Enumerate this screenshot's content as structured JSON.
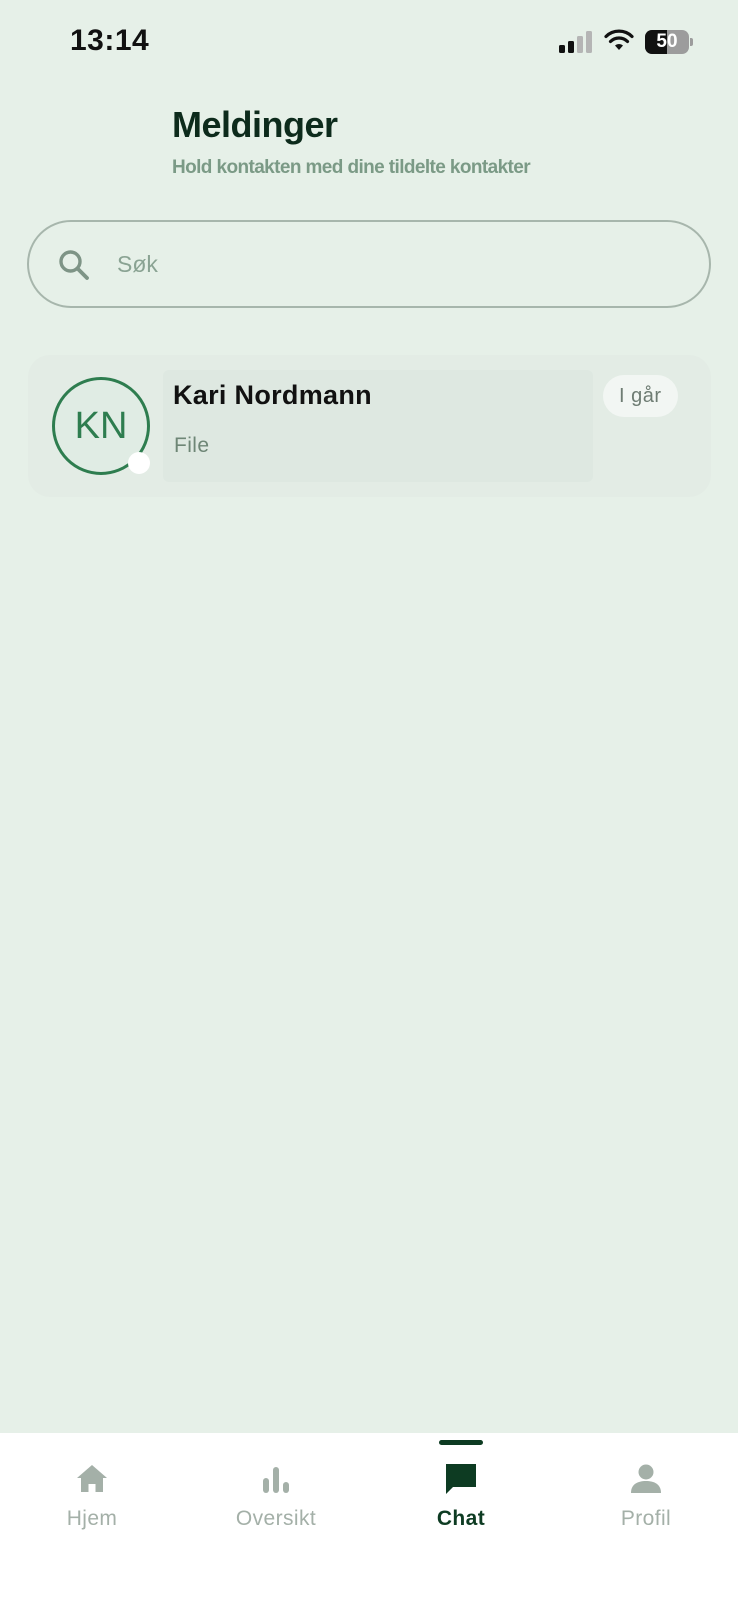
{
  "status_bar": {
    "time": "13:14",
    "battery_level": "50",
    "battery_fraction": 0.5,
    "icons": [
      "signal-icon",
      "wifi-icon",
      "battery-icon"
    ]
  },
  "header": {
    "title": "Meldinger",
    "subtitle": "Hold kontakten med dine tildelte kontakter"
  },
  "search": {
    "placeholder": "Søk",
    "value": "",
    "icon": "search-icon"
  },
  "conversations": [
    {
      "initials": "KN",
      "name": "Kari Nordmann",
      "last_message": "File",
      "time": "I går"
    }
  ],
  "bottom_nav": {
    "active": "Chat",
    "items": [
      {
        "label": "Hjem",
        "icon": "home-icon"
      },
      {
        "label": "Oversikt",
        "icon": "bar-chart-icon"
      },
      {
        "label": "Chat",
        "icon": "chat-icon"
      },
      {
        "label": "Profil",
        "icon": "person-icon"
      }
    ]
  },
  "colors": {
    "background": "#e6f0e8",
    "primary_dark": "#0d3b22",
    "accent_green": "#2e7d4f",
    "muted_text": "#7b9a86",
    "inactive_nav": "#a4b0a8"
  }
}
